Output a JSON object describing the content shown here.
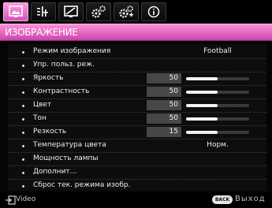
{
  "menu": {
    "tabs": [
      {
        "icon": "picture-icon",
        "active": true
      },
      {
        "icon": "audio-settings-icon",
        "active": false
      },
      {
        "icon": "display-settings-icon",
        "active": false
      },
      {
        "icon": "system-settings-icon",
        "active": false
      },
      {
        "icon": "advanced-settings-icon",
        "active": false
      },
      {
        "icon": "information-icon",
        "active": false
      }
    ],
    "accent_color": "#e46cc9",
    "section_title": "ИЗОБРАЖЕНИЕ"
  },
  "items": [
    {
      "label": "Режим изображения",
      "value": "Football"
    },
    {
      "label": "Упр. польз. реж."
    },
    {
      "label": "Яркость",
      "value": "50",
      "level": 50
    },
    {
      "label": "Контрастность",
      "value": "50",
      "level": 50
    },
    {
      "label": "Цвет",
      "value": "50",
      "level": 50
    },
    {
      "label": "Тон",
      "value": "50",
      "level": 50
    },
    {
      "label": "Резкость",
      "value": "15",
      "level": 50
    },
    {
      "label": "Температура цвета",
      "value": "Норм."
    },
    {
      "label": "Мощность лампы"
    },
    {
      "label": "Дополнит..."
    },
    {
      "label": "Сброс тек. режима изобр."
    }
  ],
  "footer": {
    "source_icon": "input-source-icon",
    "source_label": "Video",
    "back_badge": "BACK",
    "back_label": "Выход"
  }
}
